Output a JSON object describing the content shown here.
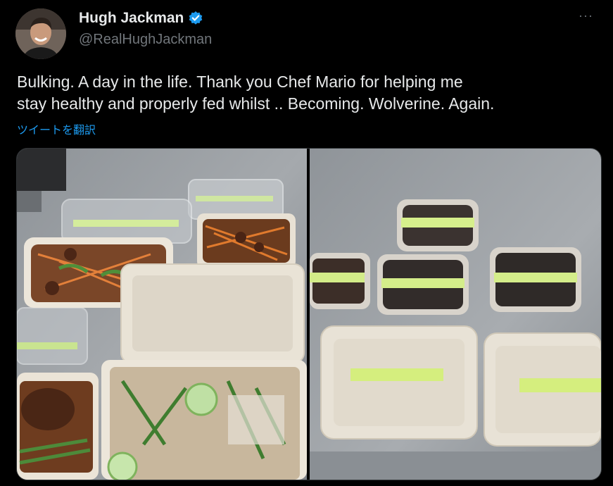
{
  "author": {
    "name": "Hugh Jackman",
    "handle": "@RealHughJackman",
    "verified_icon": "verified-badge-icon",
    "verified_color": "#1d9bf0"
  },
  "more_menu": {
    "icon": "more-options-icon",
    "glyph": "···"
  },
  "tweet": {
    "text": "Bulking.  A day in the life. Thank you Chef Mario for helping me\nstay healthy and properly fed whilst .. Becoming. Wolverine. Again.",
    "translate_label": "ツイートを翻訳"
  },
  "media": {
    "count": 2,
    "photos": [
      {
        "name": "meal-prep-photo-left",
        "content": "stainless steel counter with open takeaway containers of meat, noodles, vegetables and rice"
      },
      {
        "name": "meal-prep-photo-right",
        "content": "stainless steel counter with labelled sealed meal containers and closed clamshell boxes"
      }
    ]
  },
  "colors": {
    "background": "#000000",
    "text_primary": "#e7e9ea",
    "text_secondary": "#71767b",
    "link": "#1d9bf0"
  }
}
